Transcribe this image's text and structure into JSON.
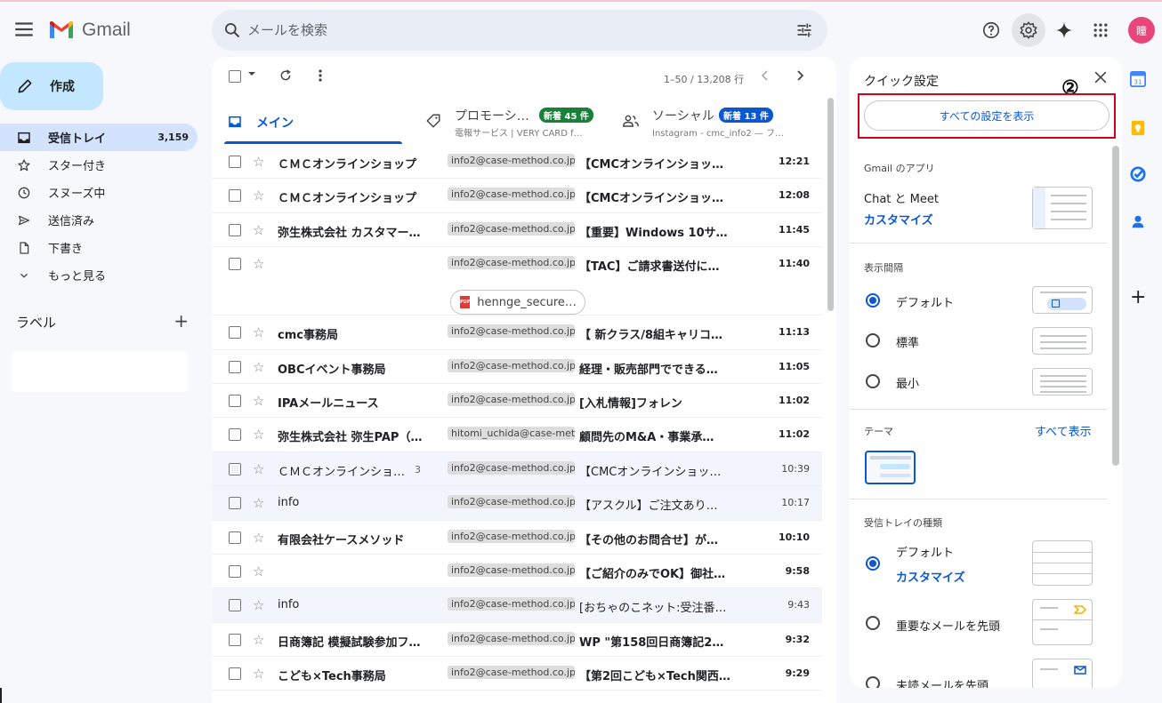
{
  "app": {
    "title": "Gmail"
  },
  "search": {
    "placeholder": "メールを検索"
  },
  "user": {
    "avatar_initial": "瞳"
  },
  "compose_label": "作成",
  "nav": [
    {
      "label": "受信トレイ",
      "count": "3,159",
      "icon": "inbox-icon",
      "active": true
    },
    {
      "label": "スター付き",
      "icon": "star-icon"
    },
    {
      "label": "スヌーズ中",
      "icon": "clock-icon"
    },
    {
      "label": "送信済み",
      "icon": "send-icon"
    },
    {
      "label": "下書き",
      "icon": "draft-icon"
    },
    {
      "label": "もっと見る",
      "icon": "chevron-down-icon"
    }
  ],
  "labels_title": "ラベル",
  "pager": "1–50 / 13,208 行",
  "tabs": [
    {
      "name": "メイン"
    },
    {
      "name": "プロモーシ…",
      "badge": "新着 45 件",
      "badge_color": "#188038",
      "sub": "電報サービス | VERY CARD f…"
    },
    {
      "name": "ソーシャル",
      "badge": "新着 13 件",
      "badge_color": "#0b57d0",
      "sub": "Instagram - cmc_info2 — フ…"
    }
  ],
  "emails": [
    {
      "sender": "ＣＭＣオンラインショップ",
      "chip": "info2@case-method.co.jp",
      "subject": "【CMCオンラインショッ…",
      "time": "12:21",
      "unread": true
    },
    {
      "sender": "ＣＭＣオンラインショップ",
      "chip": "info2@case-method.co.jp",
      "subject": "【CMCオンラインショッ…",
      "time": "12:08",
      "unread": true
    },
    {
      "sender": "弥生株式会社 カスタマー…",
      "chip": "info2@case-method.co.jp",
      "subject": "【重要】Windows 10サ…",
      "time": "11:45",
      "unread": true
    },
    {
      "sender": "",
      "chip": "info2@case-method.co.jp",
      "subject": "【TAC】ご請求書送付に…",
      "time": "11:40",
      "unread": true,
      "attachment": "hennge_secure…"
    },
    {
      "sender": "cmc事務局",
      "chip": "info2@case-method.co.jp",
      "subject": "【 新クラス/8組キャリコ…",
      "time": "11:13",
      "unread": true
    },
    {
      "sender": "OBCイベント事務局",
      "chip": "info2@case-method.co.jp",
      "subject": "経理・販売部門でできる…",
      "time": "11:05",
      "unread": true
    },
    {
      "sender": "IPAメールニュース",
      "chip": "info2@case-method.co.jp",
      "subject": "[入札情報]フォレン",
      "time": "11:02",
      "unread": true
    },
    {
      "sender": "弥生株式会社 弥生PAP（…",
      "chip": "hitomi_uchida@case-meth…",
      "subject": "顧問先のM&A・事業承…",
      "time": "11:02",
      "unread": true
    },
    {
      "sender": "ＣＭＣオンラインショ…",
      "thread": "3",
      "chip": "info2@case-method.co.jp",
      "subject": "【CMCオンラインショッ…",
      "time": "10:39",
      "unread": false
    },
    {
      "sender": "info",
      "chip": "info2@case-method.co.jp",
      "subject": "【アスクル】ご注文あり…",
      "time": "10:17",
      "unread": false
    },
    {
      "sender": "有限会社ケースメソッド",
      "chip": "info2@case-method.co.jp",
      "subject": "【その他のお問合せ】が…",
      "time": "10:10",
      "unread": true
    },
    {
      "sender": "",
      "chip": "info2@case-method.co.jp",
      "subject": "【ご紹介のみでOK】御社…",
      "time": "9:58",
      "unread": true
    },
    {
      "sender": "info",
      "chip": "info2@case-method.co.jp",
      "subject": "[おちゃのこネット:受注番…",
      "time": "9:43",
      "unread": false
    },
    {
      "sender": "日商簿記 模擬試験参加フ…",
      "chip": "info2@case-method.co.jp",
      "subject": "WP \"第158回日商簿記2級…",
      "time": "9:32",
      "unread": true
    },
    {
      "sender": "こども×Tech事務局",
      "chip": "info2@case-method.co.jp",
      "subject": "【第2回こども×Tech関西…",
      "time": "9:29",
      "unread": true
    }
  ],
  "quick_settings": {
    "title": "クイック設定",
    "all_settings": "すべての設定を表示",
    "annotation": "②",
    "apps_title": "Gmail のアプリ",
    "apps_text": "Chat と Meet",
    "apps_link": "カスタマイズ",
    "density_title": "表示間隔",
    "density": [
      "デフォルト",
      "標準",
      "最小"
    ],
    "theme_title": "テーマ",
    "theme_link": "すべて表示",
    "inbox_title": "受信トレイの種類",
    "inbox_default": "デフォルト",
    "inbox_customize": "カスタマイズ",
    "inbox_important": "重要なメールを先頭",
    "inbox_unread": "未読メールを先頭"
  },
  "colors": {
    "accent": "#0b57d0",
    "compose": "#c2e7ff",
    "highlight": "#d0021b"
  }
}
